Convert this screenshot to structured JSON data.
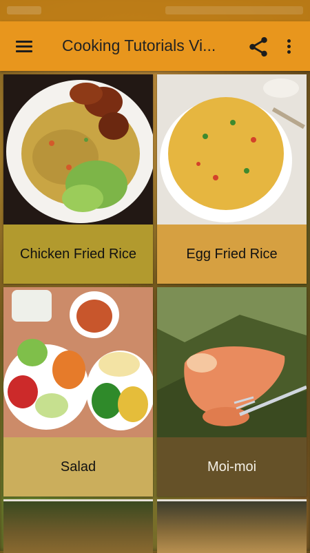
{
  "app_bar": {
    "title": "Cooking Tutorials Vi...",
    "menu_icon": "hamburger-menu-icon",
    "share_icon": "share-icon",
    "more_icon": "more-vert-icon",
    "color": "#e8961d"
  },
  "status_bar": {
    "color": "#c07e16"
  },
  "recipes": [
    {
      "label": "Chicken Fried Rice",
      "caption_color": "#b29a2e"
    },
    {
      "label": "Egg Fried Rice",
      "caption_color": "#d6a041"
    },
    {
      "label": "Salad",
      "caption_color": "#cbae5c"
    },
    {
      "label": "Moi-moi",
      "caption_color": "#655128"
    }
  ]
}
